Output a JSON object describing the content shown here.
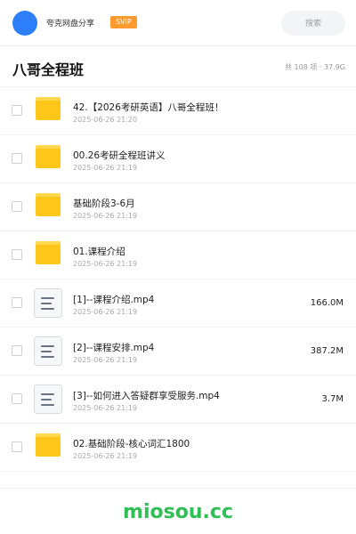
{
  "header": {
    "brand": "夸克网盘分享",
    "badge": "SVIP",
    "search_placeholder": "搜索",
    "avatar_color": "#2d7ff9",
    "badge_color": "#ff9a2e"
  },
  "folder": {
    "title": "八哥全程班",
    "summary": "共 108 项 · 37.9G"
  },
  "items": [
    {
      "type": "folder",
      "name": "42.【2026考研英语】八哥全程班！",
      "date": "2025-06-26 21:20",
      "size": ""
    },
    {
      "type": "folder",
      "name": "00.26考研全程班讲义",
      "date": "2025-06-26 21:19",
      "size": ""
    },
    {
      "type": "folder",
      "name": "基础阶段3-6月",
      "date": "2025-06-26 21:19",
      "size": ""
    },
    {
      "type": "folder",
      "name": "01.课程介绍",
      "date": "2025-06-26 21:19",
      "size": ""
    },
    {
      "type": "file",
      "name": "[1]--课程介绍.mp4",
      "date": "2025-06-26 21:19",
      "size": "166.0M"
    },
    {
      "type": "file",
      "name": "[2]--课程安排.mp4",
      "date": "2025-06-26 21:19",
      "size": "387.2M"
    },
    {
      "type": "file",
      "name": "[3]--如何进入答疑群享受服务.mp4",
      "date": "2025-06-26 21:19",
      "size": "3.7M"
    },
    {
      "type": "folder",
      "name": "02.基础阶段-核心词汇1800",
      "date": "2025-06-26 21:19",
      "size": ""
    }
  ],
  "icons": {
    "folder": "folder-icon",
    "file": "file-icon",
    "folder_color": "#ffc61a",
    "folder_tab_color": "#ffd84d"
  },
  "watermark": {
    "text": "miosou.cc",
    "color": "#2fbf55"
  }
}
